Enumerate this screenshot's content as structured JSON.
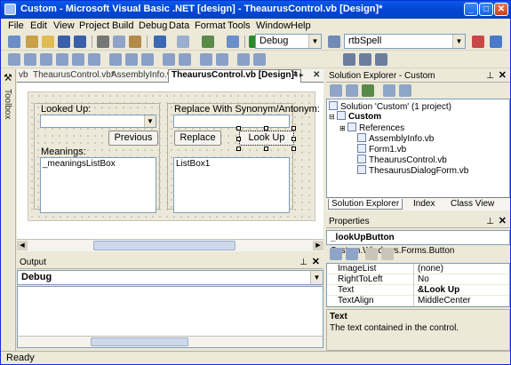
{
  "window": {
    "title": "Custom - Microsoft Visual Basic .NET [design] - TheaurusControl.vb [Design]*"
  },
  "menu": [
    "File",
    "Edit",
    "View",
    "Project",
    "Build",
    "Debug",
    "Data",
    "Format",
    "Tools",
    "Window",
    "Help"
  ],
  "toolbar": {
    "config": "Debug",
    "find": "rtbSpell"
  },
  "toolbox": {
    "label": "Toolbox"
  },
  "doc_tabs": [
    "vb",
    "TheaurusControl.vb*",
    "AssemblyInfo.vb",
    "TheaurusControl.vb [Design]*"
  ],
  "form": {
    "looked_up_label": "Looked Up:",
    "replace_label": "Replace With Synonym/Antonym:",
    "previous_button": "Previous",
    "replace_button": "Replace",
    "lookup_button": "Look Up",
    "meanings_label": "Meanings:",
    "meanings_list": "_meaningsListBox",
    "listbox1": "ListBox1"
  },
  "output": {
    "title": "Output",
    "pane": "Debug"
  },
  "solution_explorer": {
    "title": "Solution Explorer - Custom",
    "solution": "Solution 'Custom' (1 project)",
    "project": "Custom",
    "items": [
      "References",
      "AssemblyInfo.vb",
      "Form1.vb",
      "TheaurusControl.vb",
      "ThesaurusDialogForm.vb"
    ],
    "tabs": [
      "Solution Explorer",
      "Index",
      "Class View"
    ]
  },
  "properties": {
    "title": "Properties",
    "object": "_lookUpButton",
    "object_type": "System.Windows.Forms.Button",
    "rows": [
      {
        "name": "ImageList",
        "value": "(none)"
      },
      {
        "name": "RightToLeft",
        "value": "No"
      },
      {
        "name": "Text",
        "value": "&Look Up"
      },
      {
        "name": "TextAlign",
        "value": "MiddleCenter"
      }
    ],
    "desc_title": "Text",
    "desc_text": "The text contained in the control."
  },
  "status": "Ready"
}
